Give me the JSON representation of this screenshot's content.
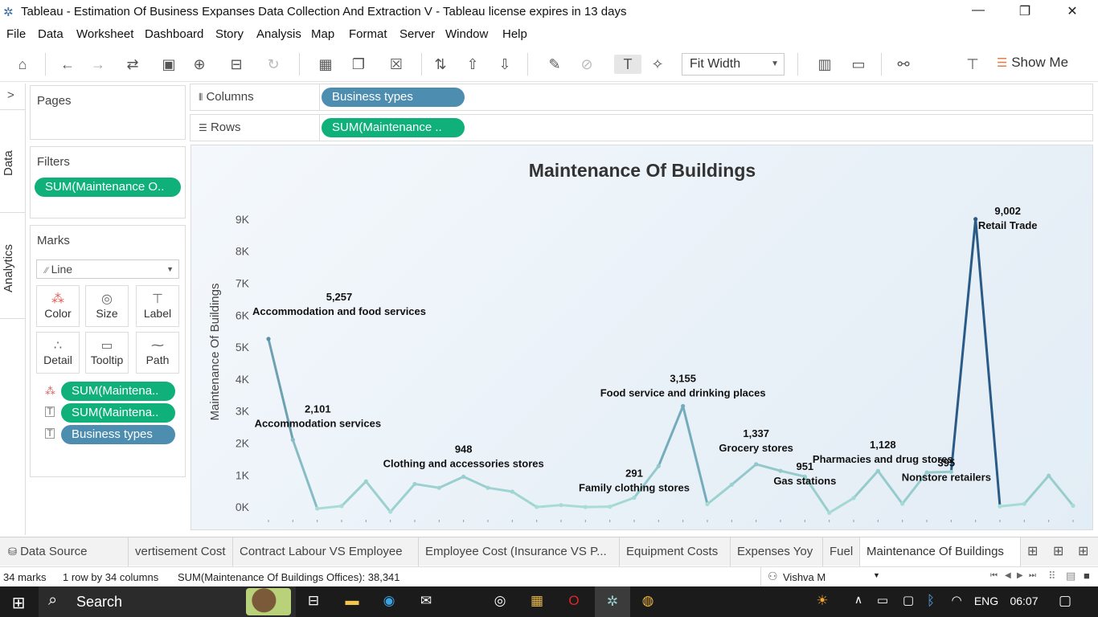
{
  "window": {
    "title": "Tableau - Estimation Of Business Expanses Data Collection And Extraction V - Tableau license expires in 13 days",
    "minimize_glyph": "—",
    "maximize_glyph": "❐",
    "close_glyph": "✕"
  },
  "menu": [
    "File",
    "Data",
    "Worksheet",
    "Dashboard",
    "Story",
    "Analysis",
    "Map",
    "Format",
    "Server",
    "Window",
    "Help"
  ],
  "toolbar": {
    "fit_label": "Fit Width",
    "show_me_label": "Show Me"
  },
  "sidebar": {
    "data_tab": "Data",
    "analytics_tab": "Analytics",
    "collapse_glyph": ">"
  },
  "pages": {
    "title": "Pages"
  },
  "filters": {
    "title": "Filters",
    "pill": "SUM(Maintenance O.."
  },
  "marks": {
    "title": "Marks",
    "type": "Line",
    "buttons": [
      "Color",
      "Size",
      "Label",
      "Detail",
      "Tooltip",
      "Path"
    ],
    "fields": [
      "SUM(Maintena..",
      "SUM(Maintena..",
      "Business types"
    ]
  },
  "shelves": {
    "columns_label": "Columns",
    "columns_pill": "Business types",
    "rows_label": "Rows",
    "rows_pill": "SUM(Maintenance .."
  },
  "chart_data": {
    "type": "line",
    "title": "Maintenance Of Buildings",
    "ylabel": "Maintenance Of Buildings",
    "xlabel": "",
    "ylim": [
      -400,
      9800
    ],
    "yticks": [
      0,
      1000,
      2000,
      3000,
      4000,
      5000,
      6000,
      7000,
      8000,
      9000
    ],
    "ytick_labels": [
      "0K",
      "1K",
      "2K",
      "3K",
      "4K",
      "5K",
      "6K",
      "7K",
      "8K",
      "9K"
    ],
    "values": [
      5257,
      2101,
      -50,
      30,
      800,
      -150,
      720,
      600,
      948,
      600,
      480,
      0,
      60,
      0,
      10,
      291,
      1280,
      3155,
      90,
      700,
      1337,
      1130,
      951,
      -180,
      280,
      1128,
      100,
      1080,
      1100,
      9002,
      20,
      100,
      980,
      40
    ],
    "labels": [
      {
        "index": 0,
        "value": "5,257",
        "name": "Accommodation and food services"
      },
      {
        "index": 1,
        "value": "2,101",
        "name": "Accommodation services"
      },
      {
        "index": 8,
        "value": "948",
        "name": "Clothing and accessories stores"
      },
      {
        "index": 15,
        "value": "291",
        "name": "Family clothing stores"
      },
      {
        "index": 17,
        "value": "3,155",
        "name": "Food service and drinking places"
      },
      {
        "index": 20,
        "value": "1,337",
        "name": "Grocery stores"
      },
      {
        "index": 22,
        "value": "951",
        "name": "Gas stations"
      },
      {
        "index": 25,
        "value": "1,128",
        "name": "Pharmacies and drug stores"
      },
      {
        "index": 28,
        "value": "395",
        "name": "Nonstore retailers"
      },
      {
        "index": 29,
        "value": "9,002",
        "name": "Retail Trade"
      }
    ],
    "grid": false,
    "colors": {
      "start": "#2f6b96",
      "end": "#a8dcd6",
      "peak": "#2a5a86"
    }
  },
  "sheet_tabs": [
    "Data Source",
    "vertisement Cost",
    "Contract Labour VS Employee",
    "Employee Cost (Insurance VS P...",
    "Equipment Costs",
    "Expenses Yoy",
    "Fuel",
    "Maintenance Of Buildings"
  ],
  "status": {
    "marks": "34 marks",
    "shape": "1 row by 34 columns",
    "sum": "SUM(Maintenance Of Buildings Offices): 38,341",
    "user": "Vishva M"
  },
  "taskbar": {
    "search": "Search",
    "language": "ENG",
    "time": "06:07"
  }
}
